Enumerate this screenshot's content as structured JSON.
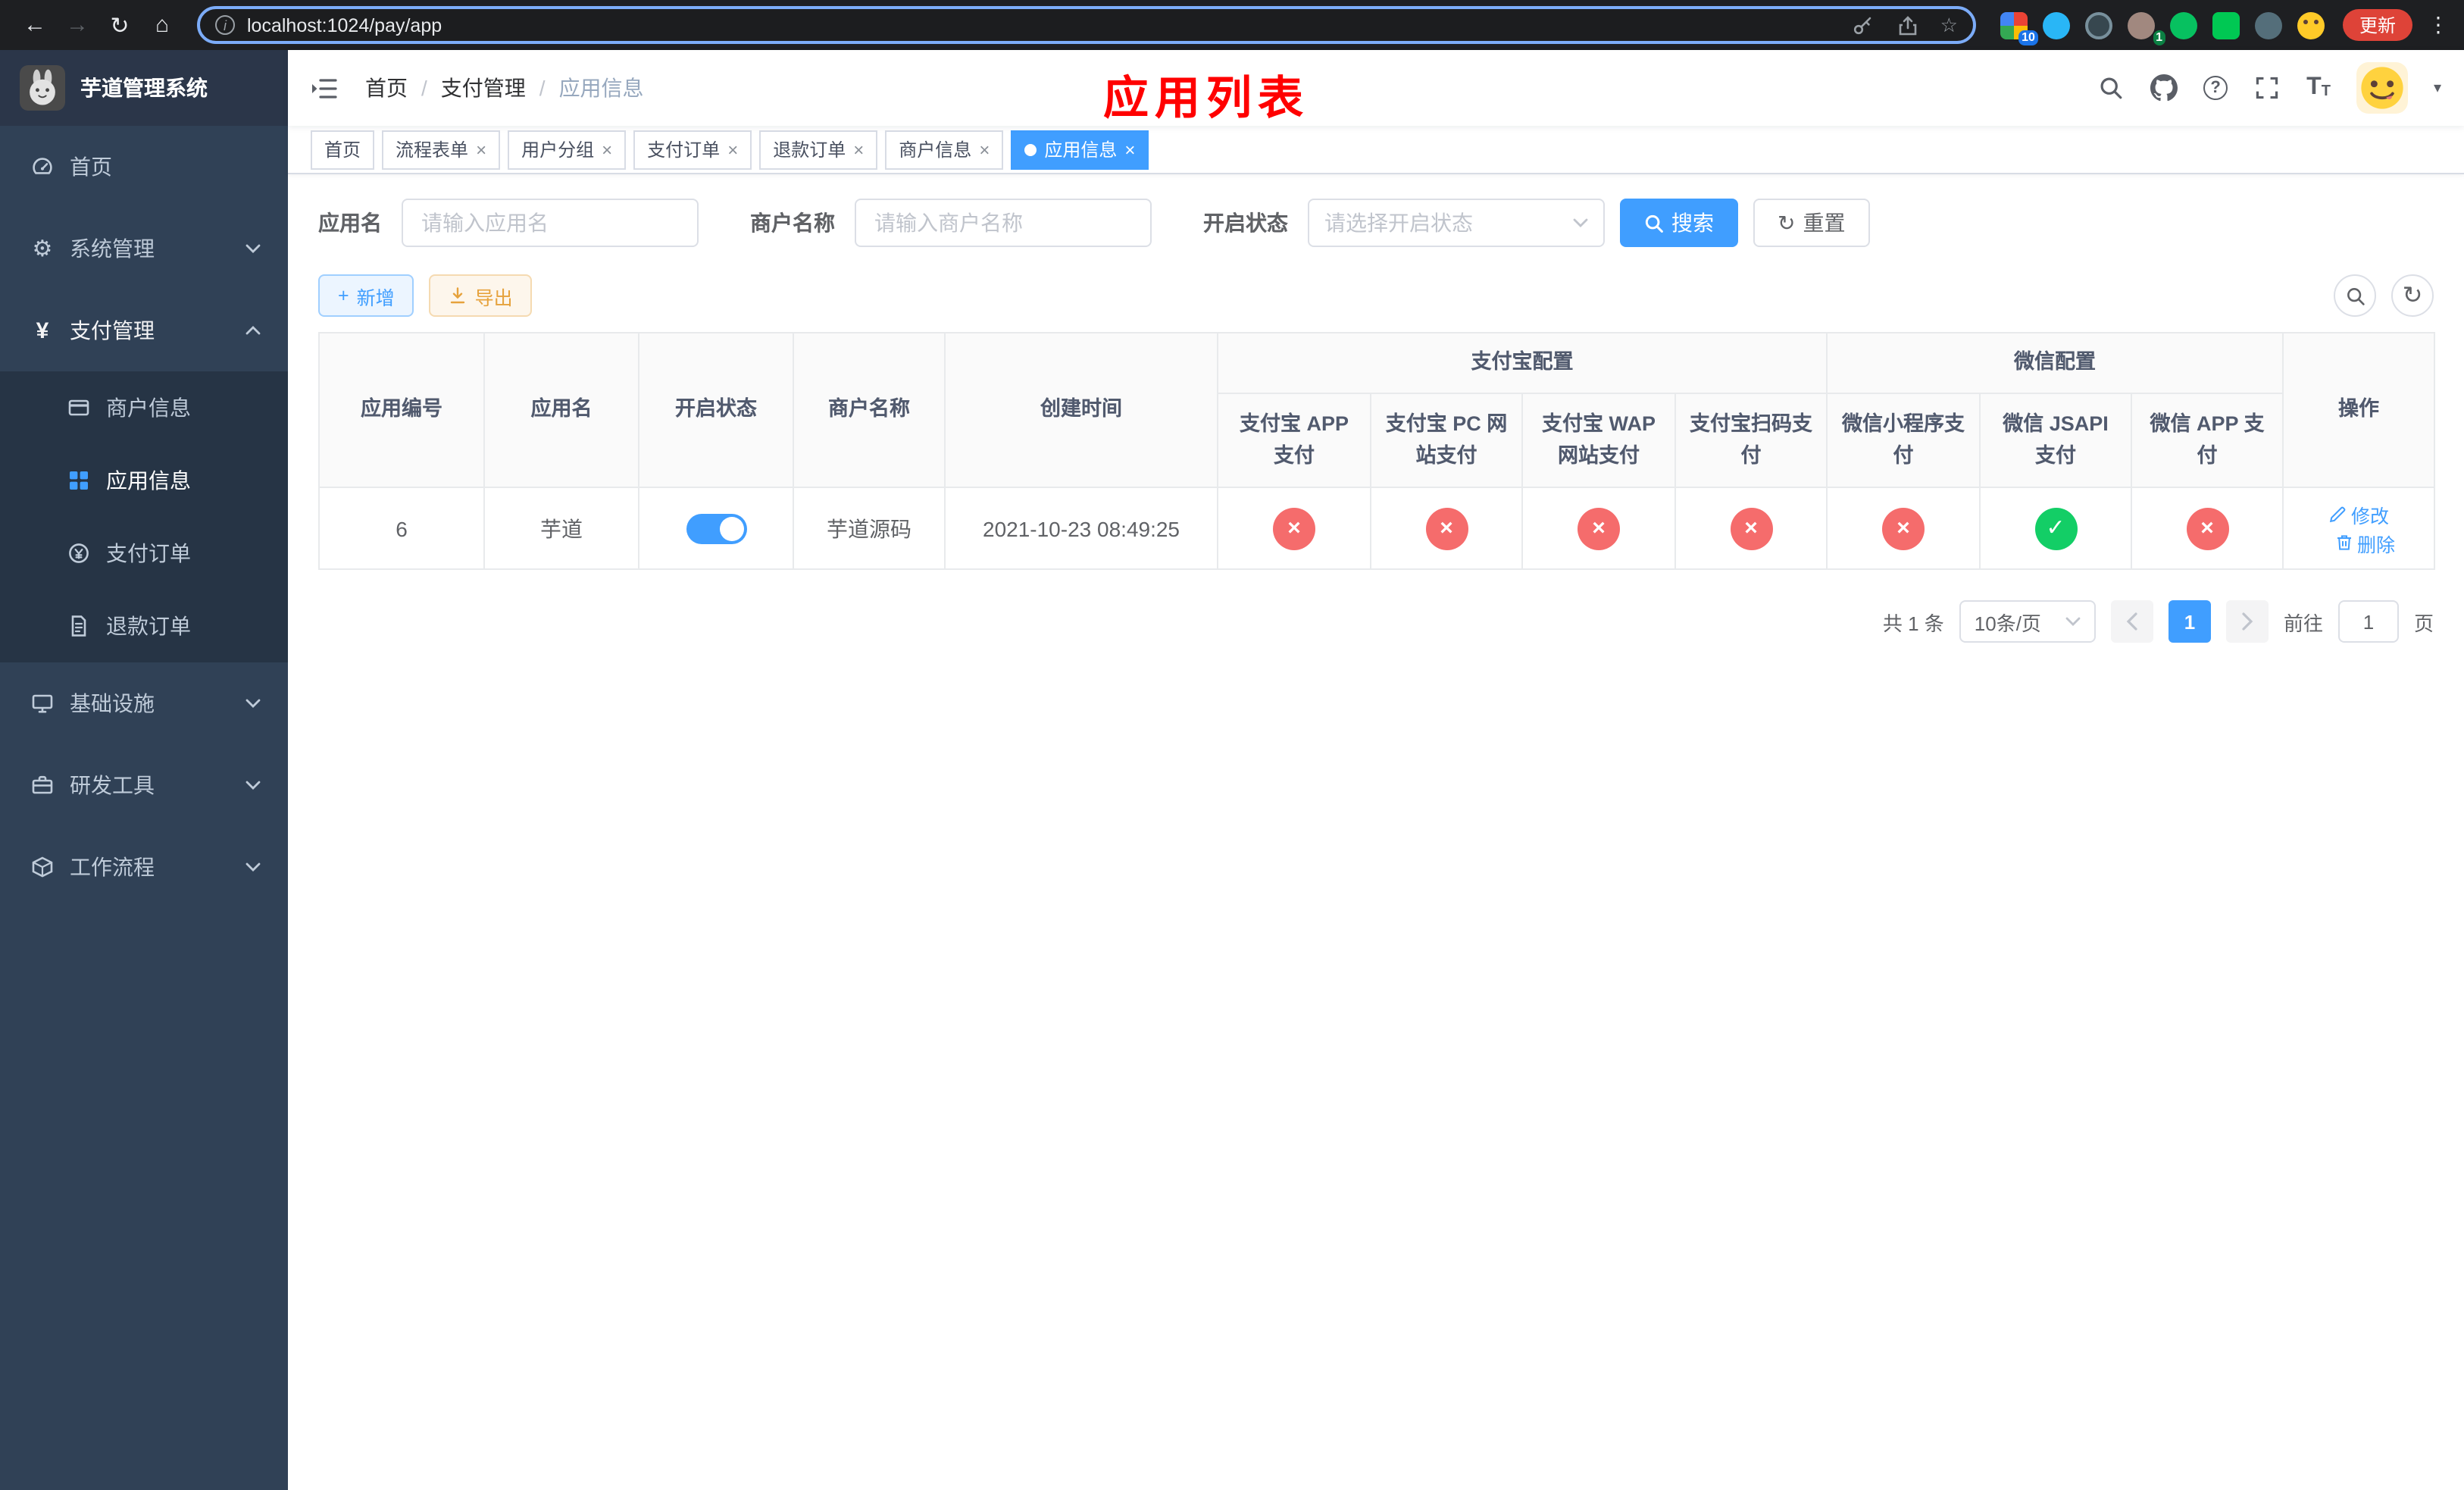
{
  "browser": {
    "url": "localhost:1024/pay/app",
    "update_label": "更新",
    "ext_badge_grid": "10",
    "ext_badge_avatar": "1"
  },
  "sidebar": {
    "title": "芋道管理系统",
    "home": "首页",
    "system": "系统管理",
    "payment": "支付管理",
    "merchant_info": "商户信息",
    "app_info": "应用信息",
    "pay_order": "支付订单",
    "refund_order": "退款订单",
    "infrastructure": "基础设施",
    "dev_tools": "研发工具",
    "workflow": "工作流程"
  },
  "navbar": {
    "breadcrumb": [
      "首页",
      "支付管理",
      "应用信息"
    ],
    "annotation": "应用列表"
  },
  "tabs": [
    {
      "label": "首页",
      "closable": false,
      "active": false
    },
    {
      "label": "流程表单",
      "closable": true,
      "active": false
    },
    {
      "label": "用户分组",
      "closable": true,
      "active": false
    },
    {
      "label": "支付订单",
      "closable": true,
      "active": false
    },
    {
      "label": "退款订单",
      "closable": true,
      "active": false
    },
    {
      "label": "商户信息",
      "closable": true,
      "active": false
    },
    {
      "label": "应用信息",
      "closable": true,
      "active": true
    }
  ],
  "filters": {
    "app_name_label": "应用名",
    "app_name_placeholder": "请输入应用名",
    "merchant_label": "商户名称",
    "merchant_placeholder": "请输入商户名称",
    "status_label": "开启状态",
    "status_placeholder": "请选择开启状态",
    "search_label": "搜索",
    "reset_label": "重置"
  },
  "toolbar": {
    "add_label": "新增",
    "export_label": "导出"
  },
  "table": {
    "group_alipay": "支付宝配置",
    "group_wechat": "微信配置",
    "col_id": "应用编号",
    "col_name": "应用名",
    "col_status": "开启状态",
    "col_merchant": "商户名称",
    "col_created": "创建时间",
    "col_alipay_app": "支付宝 APP 支付",
    "col_alipay_pc": "支付宝 PC 网站支付",
    "col_alipay_wap": "支付宝 WAP 网站支付",
    "col_alipay_qr": "支付宝扫码支付",
    "col_wx_mini": "微信小程序支付",
    "col_wx_jsapi": "微信 JSAPI 支付",
    "col_wx_app": "微信 APP 支付",
    "col_actions": "操作",
    "rows": [
      {
        "id": "6",
        "name": "芋道",
        "status": "on",
        "merchant": "芋道源码",
        "created": "2021-10-23 08:49:25",
        "alipay_app": "no",
        "alipay_pc": "no",
        "alipay_wap": "no",
        "alipay_qr": "no",
        "wx_mini": "no",
        "wx_jsapi": "yes",
        "wx_app": "no",
        "edit_label": "修改",
        "delete_label": "删除"
      }
    ]
  },
  "pagination": {
    "total": "共 1 条",
    "page_size": "10条/页",
    "current_page": "1",
    "goto_label": "前往",
    "goto_value": "1",
    "unit_label": "页"
  },
  "glyphs": {
    "cross": "×",
    "check": "✓"
  },
  "colors": {
    "primary": "#409eff",
    "danger": "#f56c6c",
    "success": "#13ce66",
    "annotation": "#ff0000"
  }
}
